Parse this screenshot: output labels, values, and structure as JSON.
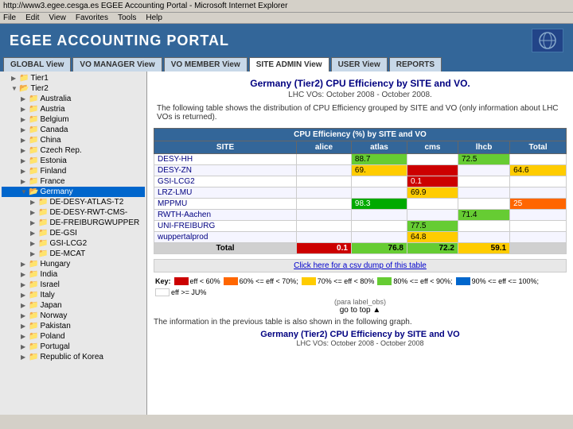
{
  "browser": {
    "address": "http://www3.egee.cesga.es   EGEE Accounting Portal - Microsoft Internet Explorer",
    "title": "http://www3.egee.cesga.es   EGEE Accounting Portal - Microsoft Internet Explorer",
    "menus": [
      "File",
      "Edit",
      "View",
      "Favorites",
      "Tools",
      "Help"
    ]
  },
  "app": {
    "title": "EGEE ACCOUNTING PORTAL",
    "nav_tabs": [
      {
        "label": "GLOBAL View",
        "active": false
      },
      {
        "label": "VO MANAGER View",
        "active": false
      },
      {
        "label": "VO MEMBER View",
        "active": false
      },
      {
        "label": "SITE ADMIN View",
        "active": true
      },
      {
        "label": "USER View",
        "active": false
      },
      {
        "label": "REPORTS",
        "active": false
      }
    ]
  },
  "sidebar": {
    "items": [
      {
        "label": "Tier1",
        "level": 1,
        "type": "folder",
        "expanded": false
      },
      {
        "label": "Tier2",
        "level": 1,
        "type": "folder",
        "expanded": true
      },
      {
        "label": "Australia",
        "level": 2,
        "type": "folder",
        "expanded": false
      },
      {
        "label": "Austria",
        "level": 2,
        "type": "folder",
        "expanded": false
      },
      {
        "label": "Belgium",
        "level": 2,
        "type": "folder",
        "expanded": false
      },
      {
        "label": "Canada",
        "level": 2,
        "type": "folder",
        "expanded": false
      },
      {
        "label": "China",
        "level": 2,
        "type": "folder",
        "expanded": false
      },
      {
        "label": "Czech Rep.",
        "level": 2,
        "type": "folder",
        "expanded": false
      },
      {
        "label": "Estonia",
        "level": 2,
        "type": "folder",
        "expanded": false
      },
      {
        "label": "Finland",
        "level": 2,
        "type": "folder",
        "expanded": false
      },
      {
        "label": "France",
        "level": 2,
        "type": "folder",
        "expanded": false
      },
      {
        "label": "Germany",
        "level": 2,
        "type": "folder",
        "expanded": true,
        "selected": true
      },
      {
        "label": "DE-DESY-ATLAS-T2",
        "level": 3,
        "type": "leaf"
      },
      {
        "label": "DE-DESY-RWT-CMS-",
        "level": 3,
        "type": "leaf"
      },
      {
        "label": "DE-FREIBURGWUPPER",
        "level": 3,
        "type": "leaf"
      },
      {
        "label": "DE-GSI",
        "level": 3,
        "type": "leaf"
      },
      {
        "label": "GSI-LCG2",
        "level": 3,
        "type": "leaf"
      },
      {
        "label": "DE-MCAT",
        "level": 3,
        "type": "leaf"
      },
      {
        "label": "Hungary",
        "level": 2,
        "type": "folder",
        "expanded": false
      },
      {
        "label": "India",
        "level": 2,
        "type": "folder",
        "expanded": false
      },
      {
        "label": "Israel",
        "level": 2,
        "type": "folder",
        "expanded": false
      },
      {
        "label": "Italy",
        "level": 2,
        "type": "folder",
        "expanded": false
      },
      {
        "label": "Japan",
        "level": 2,
        "type": "folder",
        "expanded": false
      },
      {
        "label": "Norway",
        "level": 2,
        "type": "folder",
        "expanded": false
      },
      {
        "label": "Pakistan",
        "level": 2,
        "type": "folder",
        "expanded": false
      },
      {
        "label": "Poland",
        "level": 2,
        "type": "folder",
        "expanded": false
      },
      {
        "label": "Portugal",
        "level": 2,
        "type": "folder",
        "expanded": false
      },
      {
        "label": "Republic of Korea",
        "level": 2,
        "type": "folder",
        "expanded": false
      }
    ]
  },
  "content": {
    "title": "Germany (Tier2) CPU Efficiency by SITE and VO.",
    "subtitle": "LHC VOs: October 2008 - October 2008.",
    "description": "The following table shows the distribution of CPU Efficiency grouped by SITE and VO (only information about LHC VOs is returned).",
    "table_header": "CPU Efficiency (%) by SITE and VO",
    "columns": [
      "SITE",
      "alice",
      "atlas",
      "cms",
      "lhcb",
      "Total"
    ],
    "rows": [
      {
        "site": "DESY-HH",
        "alice": "",
        "atlas": "88.7",
        "cms": "",
        "lhcb": "72.5",
        "total": "",
        "alice_color": "",
        "atlas_color": "lightgreen",
        "cms_color": "",
        "lhcb_color": "lightgreen",
        "total_color": ""
      },
      {
        "site": "DESY-ZN",
        "alice": "",
        "atlas": "69.",
        "cms": "",
        "lhcb": "",
        "total": "64.6",
        "alice_color": "",
        "atlas_color": "yellow",
        "cms_color": "red",
        "lhcb_color": "",
        "total_color": "yellow"
      },
      {
        "site": "GSI-LCG2",
        "alice": "",
        "atlas": "",
        "cms": "0.1",
        "lhcb": "",
        "total": "",
        "alice_color": "",
        "atlas_color": "",
        "cms_color": "red",
        "lhcb_color": "",
        "total_color": ""
      },
      {
        "site": "LRZ-LMU",
        "alice": "",
        "atlas": "",
        "cms": "69.9",
        "lhcb": "",
        "total": "",
        "alice_color": "",
        "atlas_color": "",
        "cms_color": "yellow",
        "lhcb_color": "",
        "total_color": ""
      },
      {
        "site": "MPPMU",
        "alice": "",
        "atlas": "98.3",
        "cms": "",
        "lhcb": "",
        "total": "25",
        "alice_color": "",
        "atlas_color": "green",
        "cms_color": "",
        "lhcb_color": "",
        "total_color": "orange"
      },
      {
        "site": "RWTH-Aachen",
        "alice": "",
        "atlas": "",
        "cms": "",
        "lhcb": "71.4",
        "total": "",
        "alice_color": "",
        "atlas_color": "",
        "cms_color": "",
        "lhcb_color": "lightgreen",
        "total_color": ""
      },
      {
        "site": "UNI-FREIBURG",
        "alice": "",
        "atlas": "",
        "cms": "77.5",
        "lhcb": "",
        "total": "",
        "alice_color": "",
        "atlas_color": "",
        "cms_color": "lightgreen",
        "lhcb_color": "",
        "total_color": ""
      },
      {
        "site": "wuppertalprod",
        "alice": "",
        "atlas": "",
        "cms": "64.8",
        "lhcb": "",
        "total": "",
        "alice_color": "",
        "atlas_color": "",
        "cms_color": "yellow",
        "lhcb_color": "",
        "total_color": ""
      }
    ],
    "total_row": {
      "label": "Total",
      "alice": "0.1",
      "atlas": "76.8",
      "cms": "72.2",
      "lhcb": "59.1",
      "total": ""
    },
    "click_link": "Click here for a csv dump of this table",
    "key_label": "Key:",
    "key_items": [
      {
        "color": "#cc0000",
        "label": "eff < 60%"
      },
      {
        "color": "#ff6600",
        "label": "60% <= eff < 70%;"
      },
      {
        "color": "#ffcc00",
        "label": "70% <= eff < 80%"
      },
      {
        "color": "#66cc33",
        "label": "80% <= eff < 90%;"
      },
      {
        "color": "#0066cc",
        "label": "90% <= eff <= 100%;"
      },
      {
        "color": "#ffffff",
        "label": "eff >= JU%"
      }
    ],
    "para_label": "(para label_obs)",
    "scroll_text": "go to top ▲",
    "graph_info": "The information in the previous table is also shown in the following graph.",
    "graph_title": "Germany (Tier2) CPU Efficiency by SITE and VO",
    "graph_subtitle": "LHC VOs: October 2008 - October 2008"
  }
}
